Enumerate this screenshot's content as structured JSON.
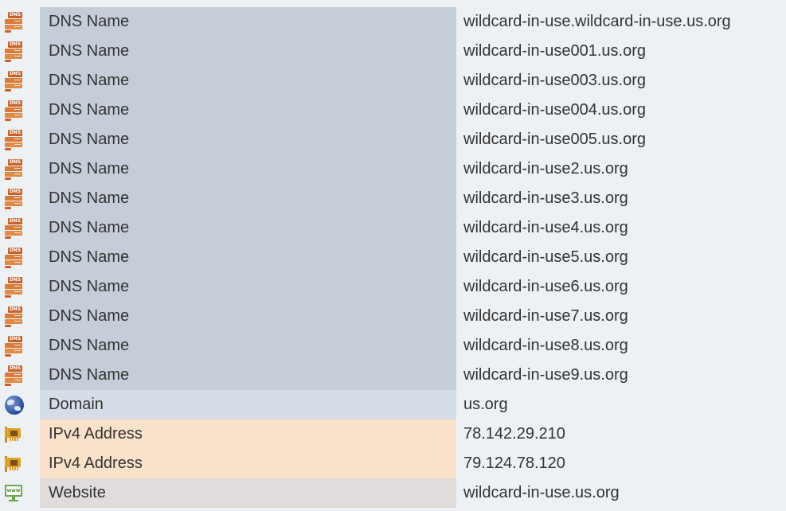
{
  "rows": [
    {
      "kind": "dns",
      "icon": "dns-icon",
      "type": "DNS Name",
      "value": "wildcard-in-use.wildcard-in-use.us.org"
    },
    {
      "kind": "dns",
      "icon": "dns-icon",
      "type": "DNS Name",
      "value": "wildcard-in-use001.us.org"
    },
    {
      "kind": "dns",
      "icon": "dns-icon",
      "type": "DNS Name",
      "value": "wildcard-in-use003.us.org"
    },
    {
      "kind": "dns",
      "icon": "dns-icon",
      "type": "DNS Name",
      "value": "wildcard-in-use004.us.org"
    },
    {
      "kind": "dns",
      "icon": "dns-icon",
      "type": "DNS Name",
      "value": "wildcard-in-use005.us.org"
    },
    {
      "kind": "dns",
      "icon": "dns-icon",
      "type": "DNS Name",
      "value": "wildcard-in-use2.us.org"
    },
    {
      "kind": "dns",
      "icon": "dns-icon",
      "type": "DNS Name",
      "value": "wildcard-in-use3.us.org"
    },
    {
      "kind": "dns",
      "icon": "dns-icon",
      "type": "DNS Name",
      "value": "wildcard-in-use4.us.org"
    },
    {
      "kind": "dns",
      "icon": "dns-icon",
      "type": "DNS Name",
      "value": "wildcard-in-use5.us.org"
    },
    {
      "kind": "dns",
      "icon": "dns-icon",
      "type": "DNS Name",
      "value": "wildcard-in-use6.us.org"
    },
    {
      "kind": "dns",
      "icon": "dns-icon",
      "type": "DNS Name",
      "value": "wildcard-in-use7.us.org"
    },
    {
      "kind": "dns",
      "icon": "dns-icon",
      "type": "DNS Name",
      "value": "wildcard-in-use8.us.org"
    },
    {
      "kind": "dns",
      "icon": "dns-icon",
      "type": "DNS Name",
      "value": "wildcard-in-use9.us.org"
    },
    {
      "kind": "domain",
      "icon": "globe-icon",
      "type": "Domain",
      "value": "us.org"
    },
    {
      "kind": "ipv4",
      "icon": "network-card-icon",
      "type": "IPv4 Address",
      "value": "78.142.29.210"
    },
    {
      "kind": "ipv4",
      "icon": "network-card-icon",
      "type": "IPv4 Address",
      "value": "79.124.78.120"
    },
    {
      "kind": "website",
      "icon": "www-icon",
      "type": "Website",
      "value": "wildcard-in-use.us.org"
    }
  ],
  "colors": {
    "dns_type_bg": "#c5ced8",
    "domain_type_bg": "#d5dde6",
    "ipv4_type_bg": "#fae1c9",
    "website_type_bg": "#e0dcdc",
    "page_bg": "#eef1f4"
  }
}
